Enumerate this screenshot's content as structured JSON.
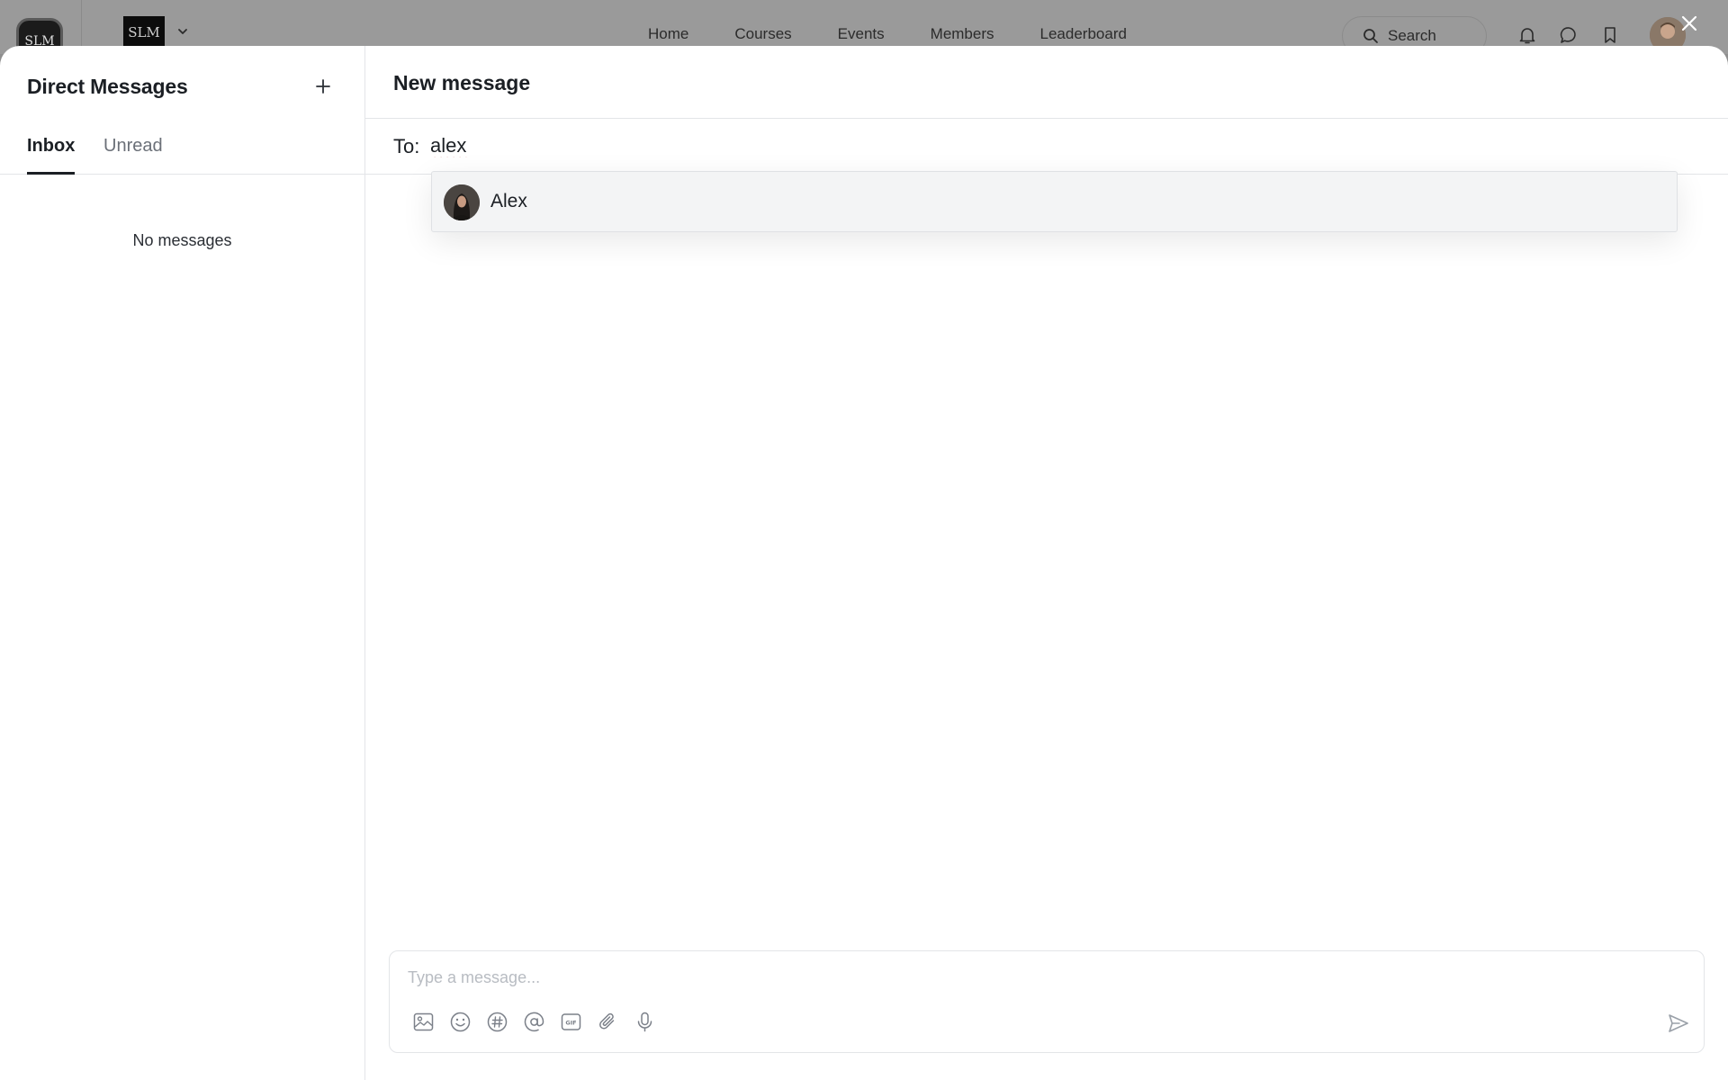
{
  "topbar": {
    "home_logo_text": "SLM",
    "space_logo_text": "SLM",
    "nav": [
      "Home",
      "Courses",
      "Events",
      "Members",
      "Leaderboard"
    ],
    "search_label": "Search"
  },
  "sidebar": {
    "title": "Direct Messages",
    "tabs": [
      "Inbox",
      "Unread"
    ],
    "active_tab": "Inbox",
    "empty_text": "No messages"
  },
  "main": {
    "title": "New message",
    "to_label": "To:",
    "to_value": "alex",
    "suggestions": [
      {
        "name": "Alex"
      }
    ],
    "composer": {
      "placeholder": "Type a message...",
      "tools": [
        "image-icon",
        "emoji-icon",
        "hashtag-icon",
        "mention-icon",
        "gif-icon",
        "attachment-icon",
        "microphone-icon"
      ],
      "send_icon": "send-icon"
    }
  }
}
